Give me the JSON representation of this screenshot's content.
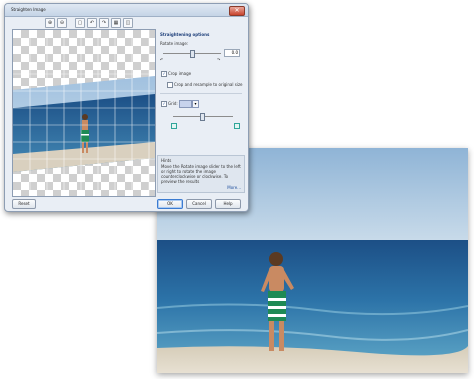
{
  "dialog": {
    "title": "Straighten Image",
    "close_glyph": "✕"
  },
  "toolbar": {
    "buttons": [
      {
        "icon": "zoom-in-icon",
        "glyph": "⊕"
      },
      {
        "icon": "zoom-out-icon",
        "glyph": "⊖"
      },
      {
        "icon": "fit-icon",
        "glyph": "▢"
      },
      {
        "icon": "rotate-left-icon",
        "glyph": "↶"
      },
      {
        "icon": "rotate-right-icon",
        "glyph": "↷"
      },
      {
        "icon": "grid-icon",
        "glyph": "▦"
      },
      {
        "icon": "compare-icon",
        "glyph": "◫"
      }
    ]
  },
  "options": {
    "title": "Straightening options",
    "rotate_label": "Rotate image:",
    "rotate_value": "0.0",
    "rotate_min_icon": "↶",
    "rotate_max_icon": "↷",
    "crop_image_label": "Crop image",
    "crop_image_checked": "✓",
    "crop_resample_label": "Crop and resample to original size",
    "grid_label": "Grid:",
    "grid_checked": "✓",
    "grid_color": "#c7d3ec",
    "dropdown_glyph": "▾"
  },
  "hint": {
    "title": "Hints",
    "text": "Move the Rotate image slider to the left or right to rotate the image counterclockwise or clockwise. To preview the results",
    "more": "More..."
  },
  "buttons": {
    "reset": "Reset",
    "ok": "OK",
    "cancel": "Cancel",
    "help": "Help"
  },
  "colors": {
    "accent": "#1e3f7a",
    "sea": "#2a6aa0",
    "sky": "#a9c6e0",
    "sand": "#d9d0bf"
  }
}
